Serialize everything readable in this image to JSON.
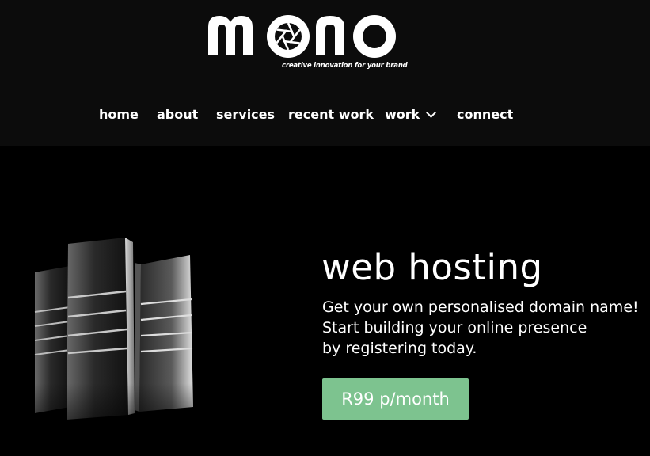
{
  "header": {
    "logo": {
      "wordmark": "mono",
      "tagline": "creative innovation for your brand"
    },
    "nav": [
      {
        "label": "home"
      },
      {
        "label": "about"
      },
      {
        "label": "services"
      },
      {
        "label": "recent work"
      },
      {
        "label": "work",
        "icon": "chevron-down-icon"
      },
      {
        "label": "connect"
      }
    ]
  },
  "hero": {
    "image": "server-racks-illustration",
    "title": "web hosting",
    "lines": [
      "Get your own personalised domain name!",
      "Start building your online presence",
      "by registering today."
    ],
    "cta_label": "R99 p/month"
  },
  "colors": {
    "header_bg": "#0c0c0c",
    "page_bg": "#000000",
    "cta_bg": "#7dc38f",
    "text": "#ffffff"
  }
}
